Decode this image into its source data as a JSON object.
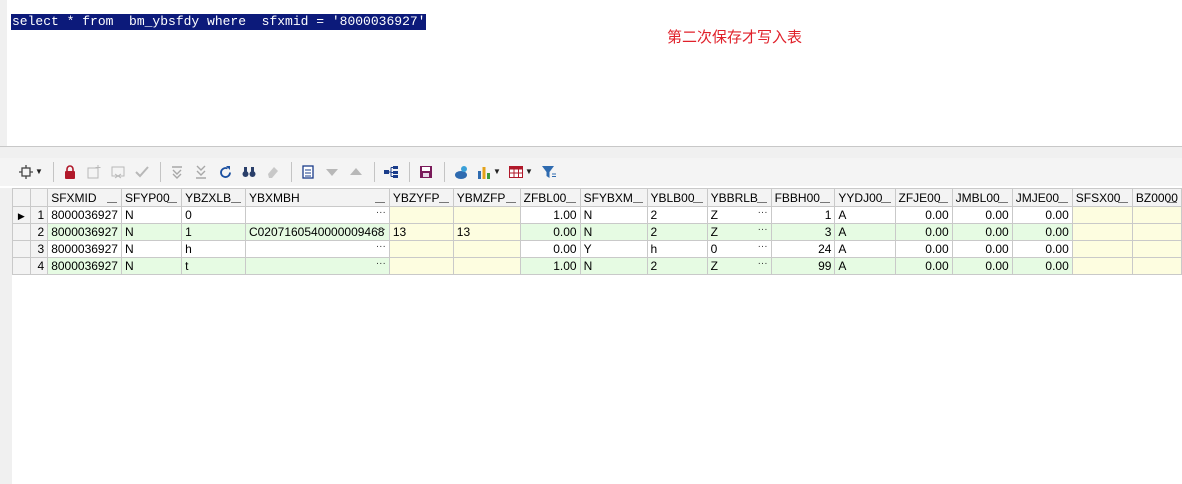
{
  "editor": {
    "sql": "select * from  bm_ybsfdy where  sfxmid = '8000036927'",
    "annotation": "第二次保存才写入表"
  },
  "toolbar": {
    "icons": [
      "settings-icon",
      "lock-icon",
      "new-record-icon",
      "discard-icon",
      "check-icon",
      "filter-down-icon",
      "filter-all-icon",
      "refresh-icon",
      "find-icon",
      "eraser-icon",
      "page-icon",
      "sort-down-icon",
      "sort-up-icon",
      "tree-icon",
      "save-icon",
      "connect-icon",
      "chart-icon",
      "table-icon",
      "funnel-icon"
    ]
  },
  "grid": {
    "columns": [
      "SFXMID",
      "SFYP00",
      "YBZXLB",
      "YBXMBH",
      "YBZYFP",
      "YBMZFP",
      "ZFBL00",
      "SFYBXM",
      "YBLB00",
      "YBBRLB",
      "FBBH00",
      "YYDJ00",
      "ZFJE00",
      "JMBL00",
      "JMJE00",
      "SFSX00",
      "BZ0000"
    ],
    "rows": [
      {
        "num": "1",
        "cells": [
          "8000036927",
          "N",
          "0",
          "",
          "",
          "",
          "1.00",
          "N",
          "2",
          "Z",
          "1",
          "A",
          "0.00",
          "0.00",
          "0.00",
          "",
          ""
        ]
      },
      {
        "num": "2",
        "cells": [
          "8000036927",
          "N",
          "1",
          "C0207160540000009468",
          "13",
          "13",
          "0.00",
          "N",
          "2",
          "Z",
          "3",
          "A",
          "0.00",
          "0.00",
          "0.00",
          "",
          ""
        ]
      },
      {
        "num": "3",
        "cells": [
          "8000036927",
          "N",
          "h",
          "",
          "",
          "",
          "0.00",
          "Y",
          "h",
          "0",
          "24",
          "A",
          "0.00",
          "0.00",
          "0.00",
          "",
          ""
        ]
      },
      {
        "num": "4",
        "cells": [
          "8000036927",
          "N",
          "t",
          "",
          "",
          "",
          "1.00",
          "N",
          "2",
          "Z",
          "99",
          "A",
          "0.00",
          "0.00",
          "0.00",
          "",
          ""
        ]
      }
    ],
    "current_row": 0
  }
}
